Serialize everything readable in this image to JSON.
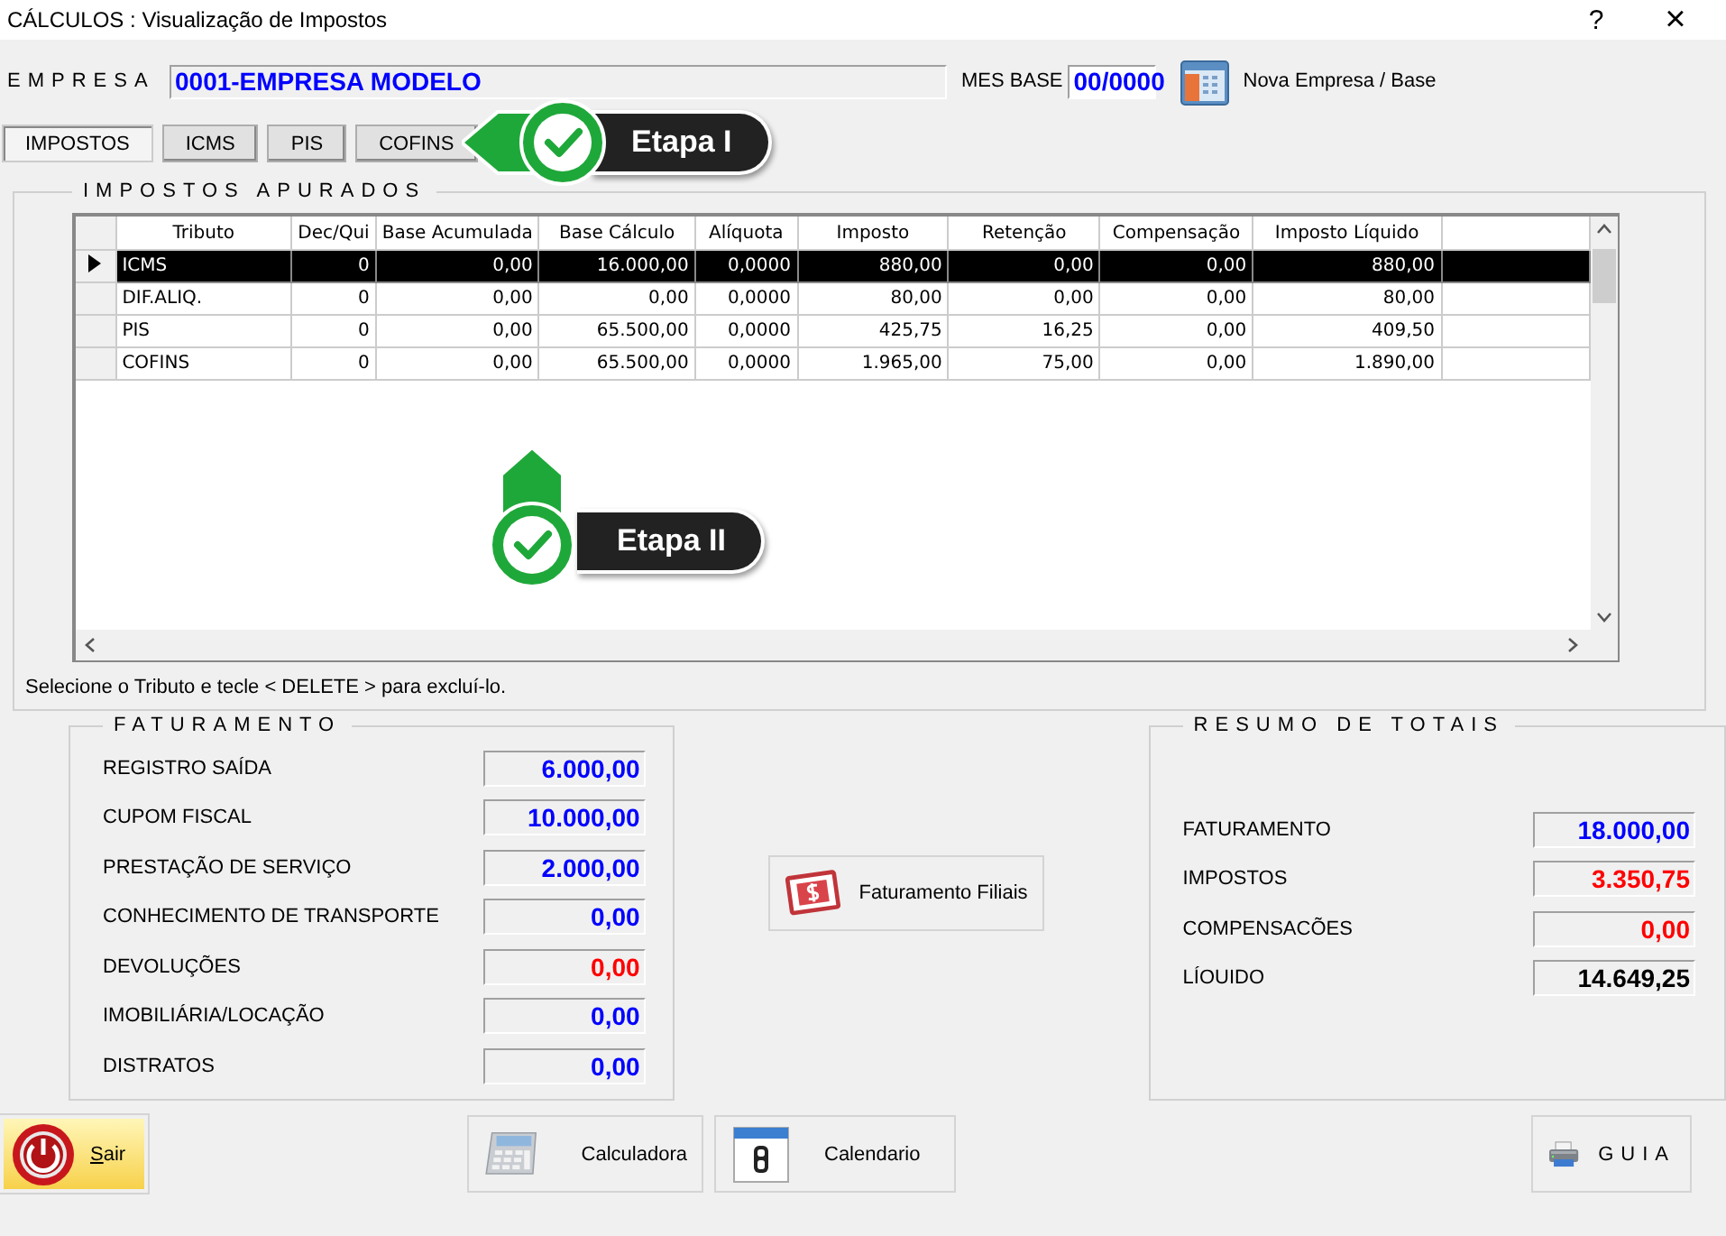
{
  "window": {
    "title": "CÁLCULOS : Visualização de Impostos",
    "help": "?",
    "close": "×"
  },
  "header": {
    "empresa_label": "EMPRESA",
    "empresa_value": "0001-EMPRESA MODELO",
    "mes_base_label": "MES BASE",
    "mes_base_value": "00/0000",
    "nova_button": "Nova Empresa / Base"
  },
  "tabs": [
    {
      "label": "IMPOSTOS",
      "selected": true
    },
    {
      "label": "ICMS",
      "selected": false
    },
    {
      "label": "PIS",
      "selected": false
    },
    {
      "label": "COFINS",
      "selected": false
    }
  ],
  "callouts": [
    {
      "label": "Etapa I",
      "kind": "left"
    },
    {
      "label": "Etapa II",
      "kind": "up"
    }
  ],
  "impostos": {
    "title": "IMPOSTOS APURADOS",
    "columns": [
      "Tributo",
      "Dec/Qui",
      "Base Acumulada",
      "Base Cálculo",
      "Alíquota",
      "Imposto",
      "Retenção",
      "Compensação",
      "Imposto Líquido"
    ],
    "rows": [
      {
        "selected": true,
        "cells": [
          "ICMS",
          "0",
          "0,00",
          "16.000,00",
          "0,0000",
          "880,00",
          "0,00",
          "0,00",
          "880,00"
        ]
      },
      {
        "selected": false,
        "cells": [
          "DIF.ALIQ.",
          "0",
          "0,00",
          "0,00",
          "0,0000",
          "80,00",
          "0,00",
          "0,00",
          "80,00"
        ]
      },
      {
        "selected": false,
        "cells": [
          "PIS",
          "0",
          "0,00",
          "65.500,00",
          "0,0000",
          "425,75",
          "16,25",
          "0,00",
          "409,50"
        ]
      },
      {
        "selected": false,
        "cells": [
          "COFINS",
          "0",
          "0,00",
          "65.500,00",
          "0,0000",
          "1.965,00",
          "75,00",
          "0,00",
          "1.890,00"
        ]
      }
    ],
    "hint": "Selecione o Tributo e tecle < DELETE > para excluí-lo."
  },
  "faturamento": {
    "title": "FATURAMENTO",
    "items": [
      {
        "label": "REGISTRO SAÍDA",
        "value": "6.000,00",
        "color": "#0000ff"
      },
      {
        "label": "CUPOM FISCAL",
        "value": "10.000,00",
        "color": "#0000ff"
      },
      {
        "label": "PRESTAÇÃO DE SERVIÇO",
        "value": "2.000,00",
        "color": "#0000ff"
      },
      {
        "label": "CONHECIMENTO DE TRANSPORTE",
        "value": "0,00",
        "color": "#0000ff"
      },
      {
        "label": "DEVOLUÇÕES",
        "value": "0,00",
        "color": "#ff0000"
      },
      {
        "label": "IMOBILIÁRIA/LOCAÇÃO",
        "value": "0,00",
        "color": "#0000ff"
      },
      {
        "label": "DISTRATOS",
        "value": "0,00",
        "color": "#0000ff"
      }
    ]
  },
  "filiais_button": "Faturamento Filiais",
  "resumo": {
    "title": "RESUMO DE TOTAIS",
    "items": [
      {
        "label": "FATURAMENTO",
        "value": "18.000,00",
        "color": "#0000ff"
      },
      {
        "label": "IMPOSTOS",
        "value": "3.350,75",
        "color": "#ff0000"
      },
      {
        "label": "COMPENSACÕES",
        "value": "0,00",
        "color": "#ff0000"
      },
      {
        "label": "LÍOUIDO",
        "value": "14.649,25",
        "color": "#000000"
      }
    ]
  },
  "buttons": [
    {
      "kind": "exit",
      "label": "Sair"
    },
    {
      "kind": "calculator",
      "label": "Calculadora"
    },
    {
      "kind": "calendar",
      "label": "Calendario"
    },
    {
      "kind": "print",
      "label": "GUIA"
    }
  ]
}
